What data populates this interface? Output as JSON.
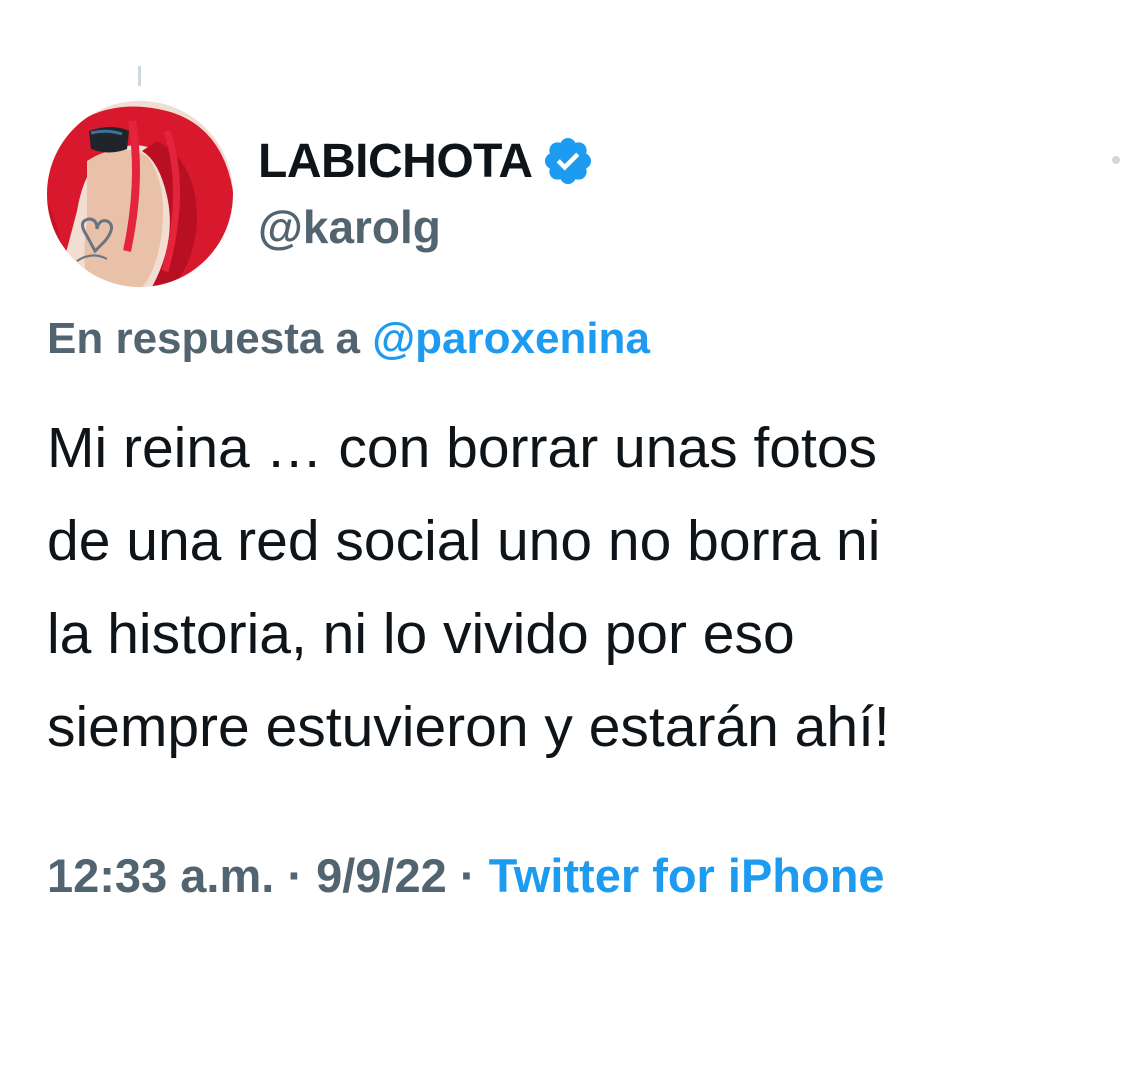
{
  "tweet": {
    "author": {
      "display_name": "LABICHOTA",
      "handle": "@karolg",
      "verified": true,
      "avatar_icon": "profile-photo-red-hair"
    },
    "reply_context": {
      "prefix": "En respuesta a",
      "mention": "@paroxenina"
    },
    "text": "Mi reina … con borrar unas fotos\nde una red social uno no borra ni\nla historia, ni lo vivido por eso\nsiempre estuvieron y estarán ahí!",
    "meta": {
      "time": "12:33 a.m.",
      "separator": "·",
      "date": "9/9/22",
      "source": "Twitter for iPhone"
    }
  },
  "colors": {
    "primary_text": "#0f1419",
    "secondary_text": "#536471",
    "accent": "#1d9bf0",
    "background": "#ffffff"
  }
}
